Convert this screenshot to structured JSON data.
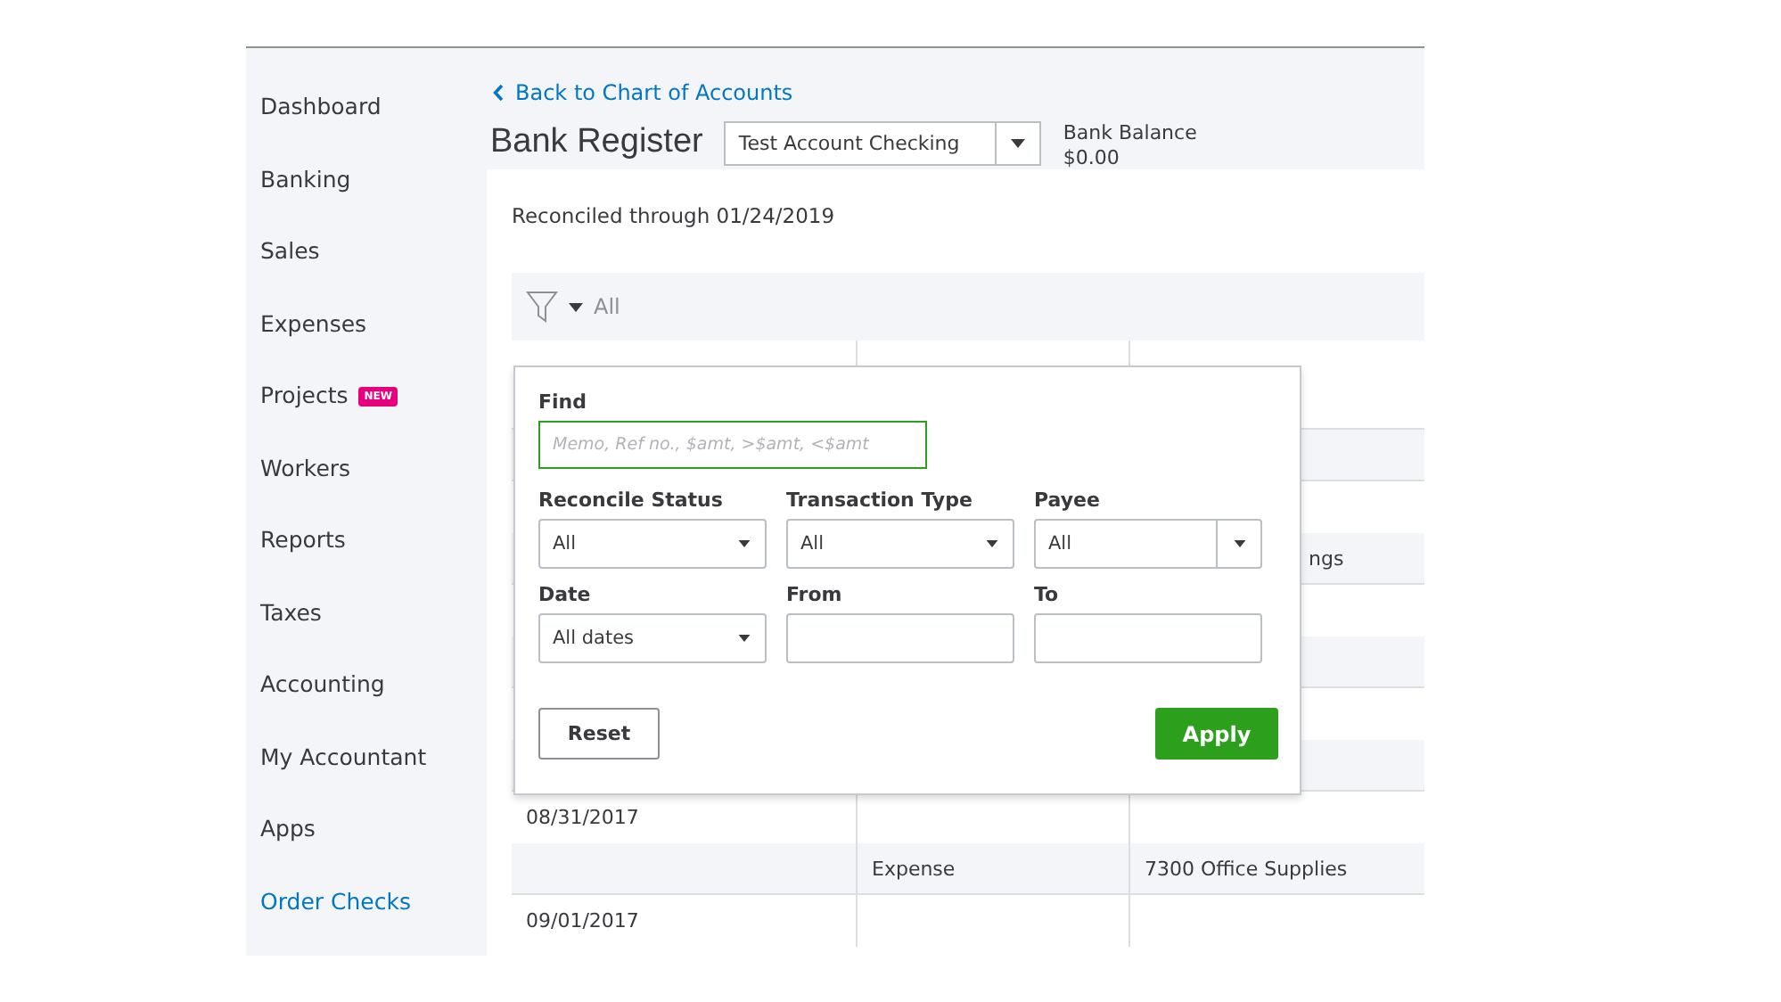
{
  "sidebar": {
    "items": [
      {
        "label": "Dashboard",
        "selected": false
      },
      {
        "label": "Banking",
        "selected": false
      },
      {
        "label": "Sales",
        "selected": false
      },
      {
        "label": "Expenses",
        "selected": false
      },
      {
        "label": "Projects",
        "selected": false,
        "badge": "NEW"
      },
      {
        "label": "Workers",
        "selected": false
      },
      {
        "label": "Reports",
        "selected": false
      },
      {
        "label": "Taxes",
        "selected": false
      },
      {
        "label": "Accounting",
        "selected": false
      },
      {
        "label": "My Accountant",
        "selected": false
      },
      {
        "label": "Apps",
        "selected": false
      },
      {
        "label": "Order Checks",
        "selected": false,
        "kind": "link"
      }
    ]
  },
  "header": {
    "back_link": "Back to Chart of Accounts",
    "title": "Bank Register",
    "account": "Test Account Checking",
    "balance_label": "Bank Balance",
    "balance": "$0.00"
  },
  "reconciled": "Reconciled through 01/24/2019",
  "filter_bar": {
    "label": "All"
  },
  "register_rows": [
    {
      "shaded": true
    },
    {
      "shaded": true,
      "column_3": "ngs"
    },
    {
      "shaded": true
    },
    {
      "shaded": true
    },
    {
      "shaded": false,
      "date": "08/31/2017"
    },
    {
      "shaded": true,
      "column_2": "Expense",
      "column_3": "7300 Office Supplies"
    },
    {
      "shaded": false,
      "date": "09/01/2017"
    }
  ],
  "filter_popup": {
    "find_label": "Find",
    "find_placeholder": "Memo, Ref no., $amt, >$amt, <$amt",
    "fields": [
      {
        "label": "Reconcile Status",
        "kind": "select",
        "value": "All"
      },
      {
        "label": "Transaction Type",
        "kind": "select",
        "value": "All"
      },
      {
        "label": "Payee",
        "kind": "combo",
        "value": "All"
      },
      {
        "label": "Date",
        "kind": "select",
        "value": "All dates"
      },
      {
        "label": "From",
        "kind": "input"
      },
      {
        "label": "To",
        "kind": "input"
      }
    ],
    "reset": "Reset",
    "apply": "Apply"
  }
}
